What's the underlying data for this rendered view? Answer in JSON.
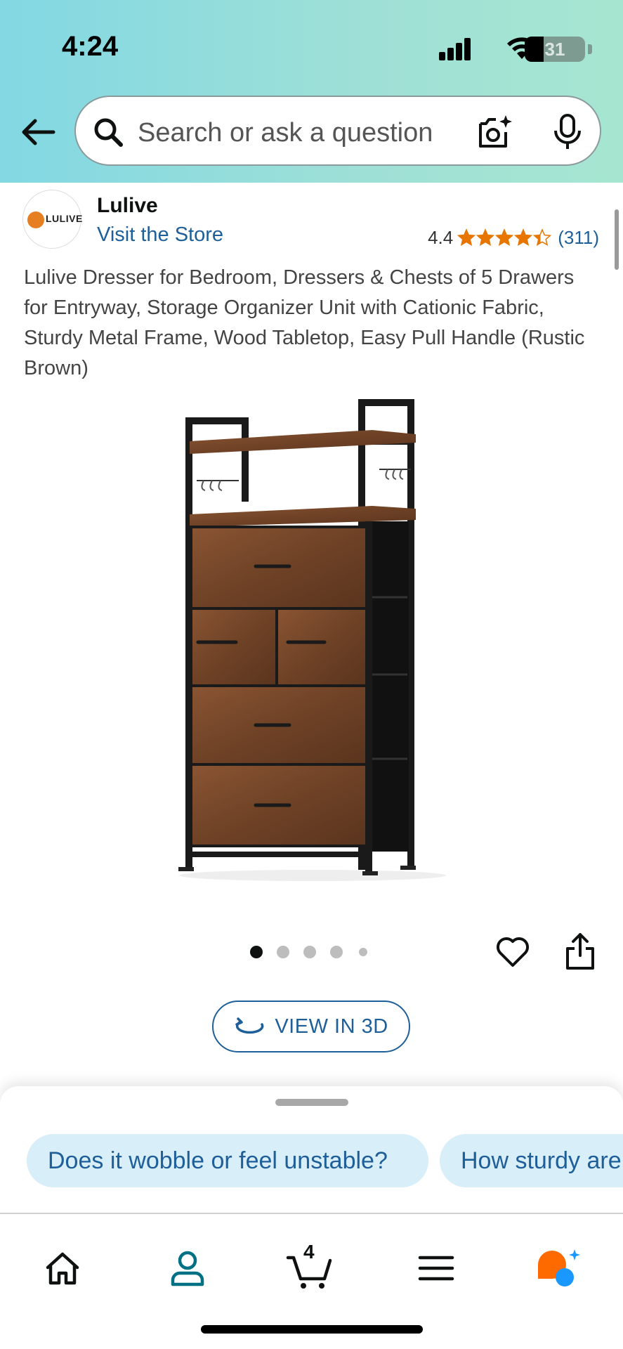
{
  "status_bar": {
    "time": "4:24",
    "battery": "31",
    "battery_level": 0.31
  },
  "search": {
    "placeholder": "Search or ask a question"
  },
  "store": {
    "logo_text": "LULIVE",
    "brand": "Lulive",
    "visit_label": "Visit the Store",
    "rating": "4.4",
    "rating_stars": 4.4,
    "review_count": "(311)"
  },
  "product": {
    "title": "Lulive Dresser for Bedroom, Dressers & Chests of 5 Drawers for Entryway, Storage Organizer Unit with Cationic Fabric, Sturdy Metal Frame, Wood Tabletop, Easy Pull Handle (Rustic Brown)",
    "image_count": 5,
    "active_image": 1
  },
  "view_3d": {
    "label": "VIEW IN 3D"
  },
  "questions": [
    "Does it wobble or feel unstable?",
    "How sturdy are"
  ],
  "tab_bar": {
    "cart_count": "4",
    "tabs": [
      "home-icon",
      "account-icon",
      "cart-icon",
      "menu-icon",
      "rufus-icon"
    ]
  },
  "colors": {
    "link": "#1f5f99",
    "star": "#e77600",
    "chip_bg": "#d8eef9",
    "account_teal": "#007185",
    "rufus_orange": "#ff6a00",
    "rufus_blue": "#1a98ff"
  }
}
